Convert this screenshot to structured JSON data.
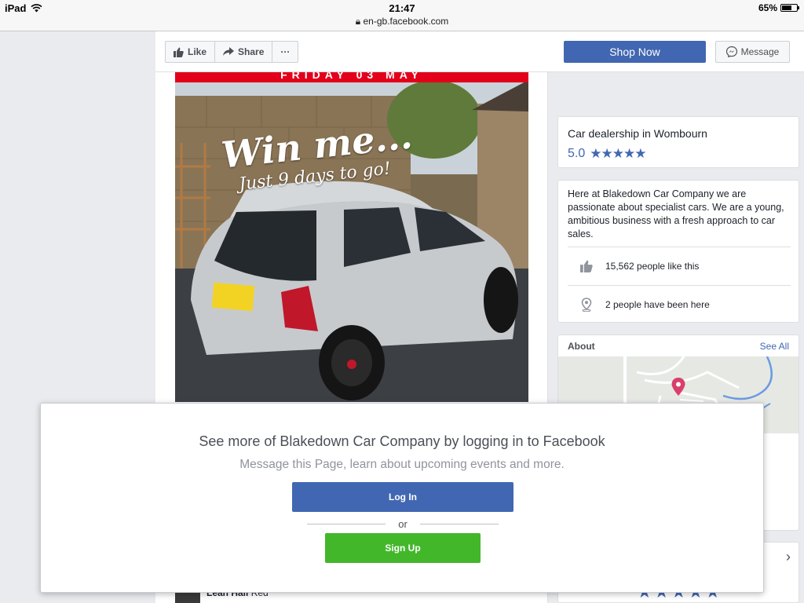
{
  "status_bar": {
    "device": "iPad",
    "time": "21:47",
    "url": "en-gb.facebook.com",
    "battery": "65%",
    "battery_level": 0.65
  },
  "action_bar": {
    "like_label": "Like",
    "share_label": "Share",
    "more_label": "···",
    "shop_now_label": "Shop Now",
    "message_label": "Message"
  },
  "post": {
    "banner_text": "FRIDAY 03 MAY",
    "headline": "Win me...",
    "subline": "Just 9 days to go!"
  },
  "sidebar": {
    "category": "Car dealership in Wombourn",
    "rating": "5.0",
    "stars": "★★★★★",
    "description": "Here at Blakedown Car Company we are passionate about specialist cars. We are a young, ambitious business with a fresh approach to car sales.",
    "likes_text": "15,562 people like this",
    "visits_text": "2 people have been here",
    "about_label": "About",
    "see_all_label": "See All",
    "bottom_stars": "★★★★★",
    "chevron": "›"
  },
  "comment_peek": {
    "name": "Leah Hall",
    "snippet": "Red"
  },
  "login_prompt": {
    "title": "See more of Blakedown Car Company by logging in to Facebook",
    "subtitle": "Message this Page, learn about upcoming events and more.",
    "login_label": "Log In",
    "or_label": "or",
    "signup_label": "Sign Up"
  },
  "colors": {
    "facebook_blue": "#4267b2",
    "signup_green": "#42b72a",
    "banner_red": "#e3001b",
    "map_pin": "#d93f6a"
  }
}
